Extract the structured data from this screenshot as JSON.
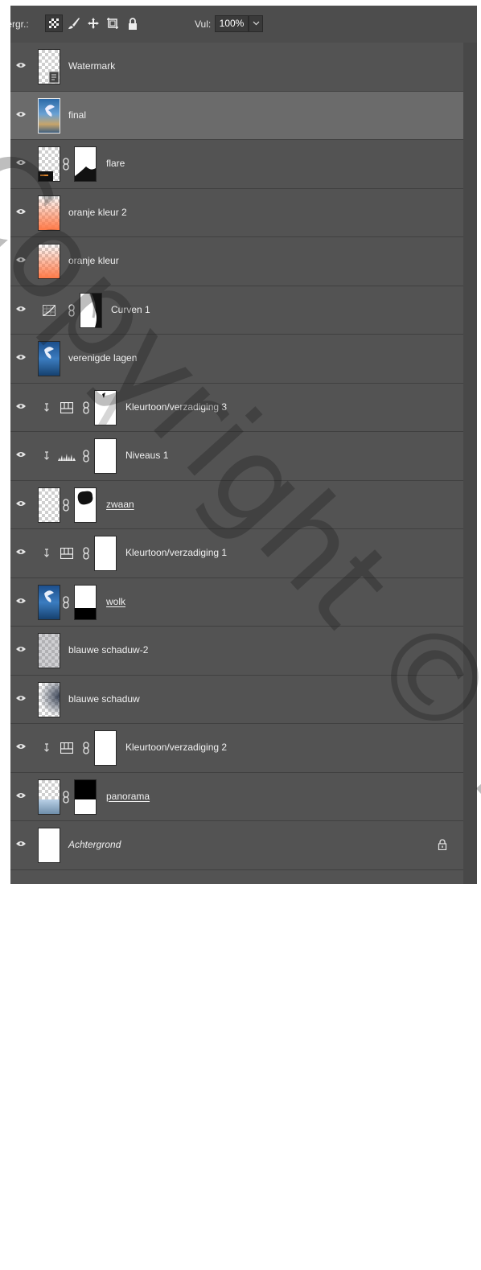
{
  "toolbar": {
    "lock_label": "Vergr.:",
    "fill_label": "Vul:",
    "fill_value": "100%",
    "icons": [
      "lock-transparent-pixels-icon",
      "brush-icon",
      "move-icon",
      "crop-artboard-icon",
      "lock-all-icon",
      "chevron-down-icon"
    ]
  },
  "layers": [
    {
      "name": "Watermark",
      "thumb": "smart-object",
      "mask": false,
      "clip": false,
      "adjust": null,
      "style": "",
      "selected": false
    },
    {
      "name": "final",
      "thumb": "photo",
      "mask": false,
      "clip": false,
      "adjust": null,
      "style": "",
      "selected": true
    },
    {
      "name": "flare",
      "thumb": "flare",
      "mask": "flare-mask",
      "clip": false,
      "adjust": null,
      "style": "",
      "selected": false
    },
    {
      "name": "oranje kleur 2",
      "thumb": "orange",
      "mask": false,
      "clip": false,
      "adjust": null,
      "style": "",
      "selected": false
    },
    {
      "name": "oranje kleur",
      "thumb": "orange",
      "mask": false,
      "clip": false,
      "adjust": null,
      "style": "",
      "selected": false
    },
    {
      "name": "Curven 1",
      "thumb": null,
      "mask": "curve-mask",
      "clip": false,
      "adjust": "curves-icon",
      "style": "",
      "selected": false
    },
    {
      "name": "verenigde lagen",
      "thumb": "photo-blue",
      "mask": false,
      "clip": false,
      "adjust": null,
      "style": "",
      "selected": false
    },
    {
      "name": "Kleurtoon/verzadiging 3",
      "thumb": null,
      "mask": "diag-mask",
      "clip": true,
      "adjust": "hue-saturation-icon",
      "style": "",
      "selected": false
    },
    {
      "name": "Niveaus 1",
      "thumb": null,
      "mask": "white-mask",
      "clip": true,
      "adjust": "levels-icon",
      "style": "",
      "selected": false
    },
    {
      "name": "zwaan",
      "thumb": "checker",
      "mask": "blob-mask",
      "clip": false,
      "adjust": null,
      "style": "underline",
      "selected": false
    },
    {
      "name": "Kleurtoon/verzadiging 1",
      "thumb": null,
      "mask": "white-mask",
      "clip": true,
      "adjust": "hue-saturation-icon",
      "style": "",
      "selected": false
    },
    {
      "name": "wolk",
      "thumb": "photo-blue",
      "mask": "bottom-black-mask",
      "clip": false,
      "adjust": null,
      "style": "underline",
      "selected": false
    },
    {
      "name": "blauwe schaduw-2",
      "thumb": "checker-gray",
      "mask": false,
      "clip": false,
      "adjust": null,
      "style": "",
      "selected": false
    },
    {
      "name": "blauwe  schaduw",
      "thumb": "checker-shadow",
      "mask": false,
      "clip": false,
      "adjust": null,
      "style": "",
      "selected": false
    },
    {
      "name": "Kleurtoon/verzadiging 2",
      "thumb": null,
      "mask": "white-mask",
      "clip": true,
      "adjust": "hue-saturation-icon",
      "style": "",
      "selected": false
    },
    {
      "name": "panorama",
      "thumb": "panorama",
      "mask": "top-black-mask",
      "clip": false,
      "adjust": null,
      "style": "underline",
      "selected": false
    },
    {
      "name": "Achtergrond",
      "thumb": "white",
      "mask": false,
      "clip": false,
      "adjust": null,
      "style": "italic",
      "selected": false,
      "locked": true
    }
  ],
  "watermark_text": "Copyright © Photoshop",
  "colors": {
    "panel": "#535353",
    "selected": "#6b6b6b",
    "text": "#f0f0f0"
  }
}
